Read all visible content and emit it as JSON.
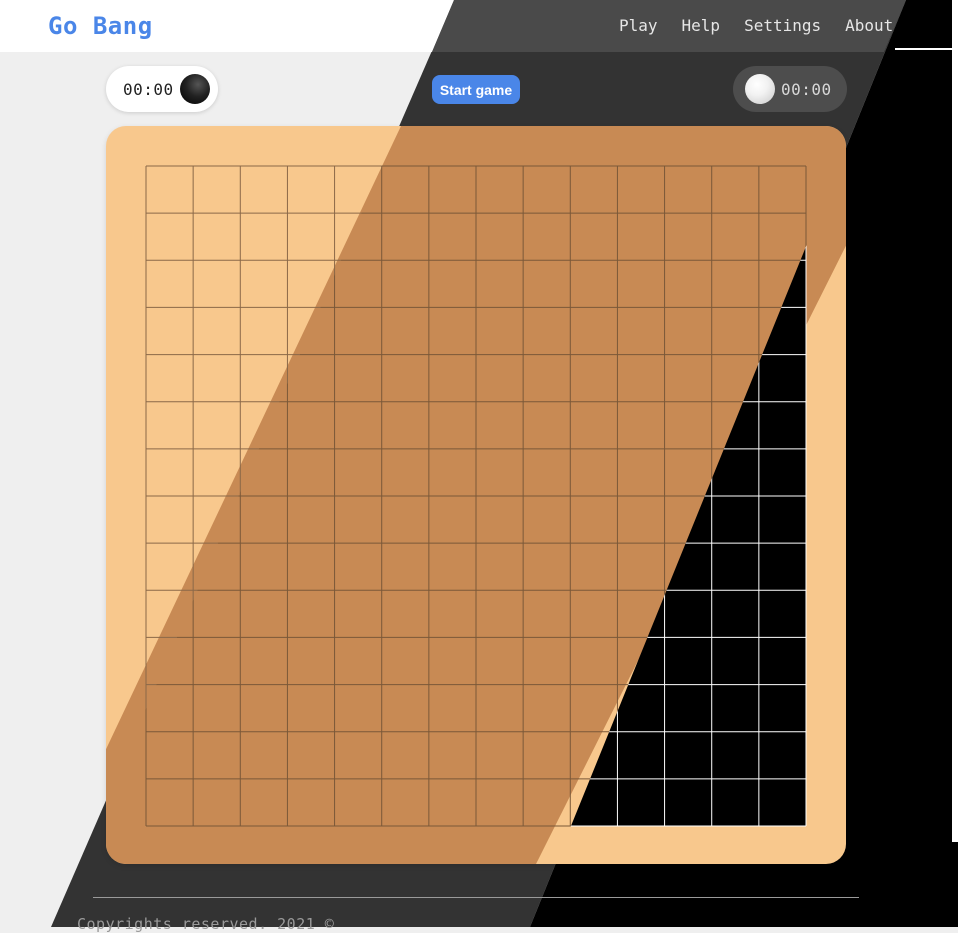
{
  "app": {
    "logo": "Go Bang",
    "brand_color": "#4a86e8"
  },
  "nav": [
    {
      "label": "Play"
    },
    {
      "label": "Help"
    },
    {
      "label": "Settings"
    },
    {
      "label": "About"
    }
  ],
  "players": {
    "black": {
      "time": "00:00",
      "stone": "black-stone-icon"
    },
    "white": {
      "time": "00:00",
      "stone": "white-stone-icon"
    }
  },
  "controls": {
    "start_label": "Start game"
  },
  "board": {
    "columns": 14,
    "rows": 14,
    "wood_light": "#f8c88d",
    "wood_dark": "#c88a54",
    "line_color": "#7a5a3c"
  },
  "footer": {
    "text": "Copyrights reserved. 2021 ©"
  }
}
